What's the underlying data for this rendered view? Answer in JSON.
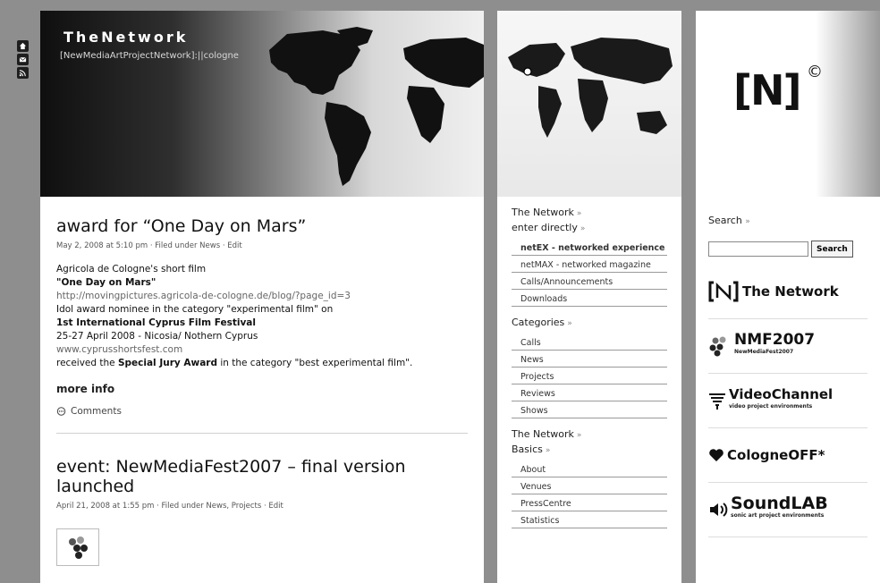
{
  "left_icons": [
    "home-icon",
    "mail-icon",
    "rss-icon"
  ],
  "header": {
    "title": "TheNetwork",
    "subtitle": "[NewMediaArtProjectNetwork]:||cologne"
  },
  "posts": [
    {
      "title": "award for “One Day on Mars”",
      "meta": "May 2, 2008 at 5:10 pm · Filed under News · Edit",
      "lines": [
        "Agricola de Cologne's short film",
        "\"One Day on Mars\"",
        "http://movingpictures.agricola-de-cologne.de/blog/?page_id=3",
        "Idol award nominee in the category \"experimental film\" on",
        "1st International Cyprus Film Festival",
        "25-27 April 2008 - Nicosia/ Nothern Cyprus",
        "www.cyprusshortsfest.com"
      ],
      "award_prefix": "received the ",
      "award_bold": "Special Jury Award",
      "award_suffix": " in the category \"best experimental film\".",
      "more": "more info",
      "comments": "Comments"
    },
    {
      "title": "event: NewMediaFest2007 – final version launched",
      "meta": "April 21, 2008 at 1:55 pm · Filed under News, Projects · Edit"
    }
  ],
  "mid": {
    "enter_title_1": "The Network",
    "enter_title_2": "enter directly",
    "enter_items": [
      "netEX - networked experience",
      "netMAX - networked magazine",
      "Calls/Announcements",
      "Downloads"
    ],
    "categories_title": "Categories",
    "categories": [
      "Calls",
      "News",
      "Projects",
      "Reviews",
      "Shows"
    ],
    "basics_title_1": "The Network",
    "basics_title_2": "Basics",
    "basics": [
      "About",
      "Venues",
      "PressCentre",
      "Statistics"
    ],
    "arrow": "»"
  },
  "right": {
    "logo": "[N]",
    "logo_mark": "©",
    "search_label": "Search",
    "search_button": "Search",
    "banners": [
      {
        "name": "The Network",
        "sub": ""
      },
      {
        "name": "NMF2007",
        "sub": "NewMediaFest2007"
      },
      {
        "name": "VideoChannel",
        "sub": "video project environments"
      },
      {
        "name": "CologneOFF*",
        "sub": ""
      },
      {
        "name": "SoundLAB",
        "sub": "sonic art project environments"
      }
    ]
  }
}
